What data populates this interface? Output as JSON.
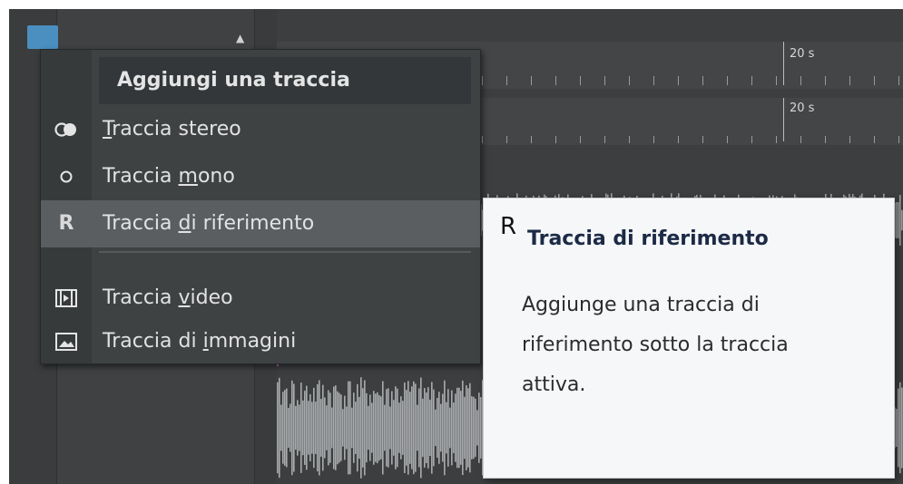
{
  "menu": {
    "header": "Aggiungi una traccia",
    "items": [
      {
        "pre": "",
        "u": "T",
        "post": "raccia stereo",
        "icon": "stereo-icon"
      },
      {
        "pre": "Traccia ",
        "u": "m",
        "post": "ono",
        "icon": "mono-icon"
      },
      {
        "pre": "Traccia ",
        "u": "d",
        "post": "i riferimento",
        "icon": "reference-icon"
      },
      {
        "pre": "Traccia ",
        "u": "v",
        "post": "ideo",
        "icon": "video-icon"
      },
      {
        "pre": "Traccia di ",
        "u": "i",
        "post": "mmagini",
        "icon": "image-icon"
      }
    ],
    "reference_glyph": "R"
  },
  "tooltip": {
    "icon": "R",
    "title": "Traccia di riferimento",
    "description": "Aggiunge una traccia di riferimento sotto la traccia attiva."
  },
  "ruler": {
    "label_top": "20 s",
    "label_mid": "20 s"
  },
  "colors": {
    "accent": "#4a8fbf",
    "cursor": "#d25ad2",
    "menu_bg": "#3f4243",
    "tooltip_bg": "#f5f7f9"
  }
}
